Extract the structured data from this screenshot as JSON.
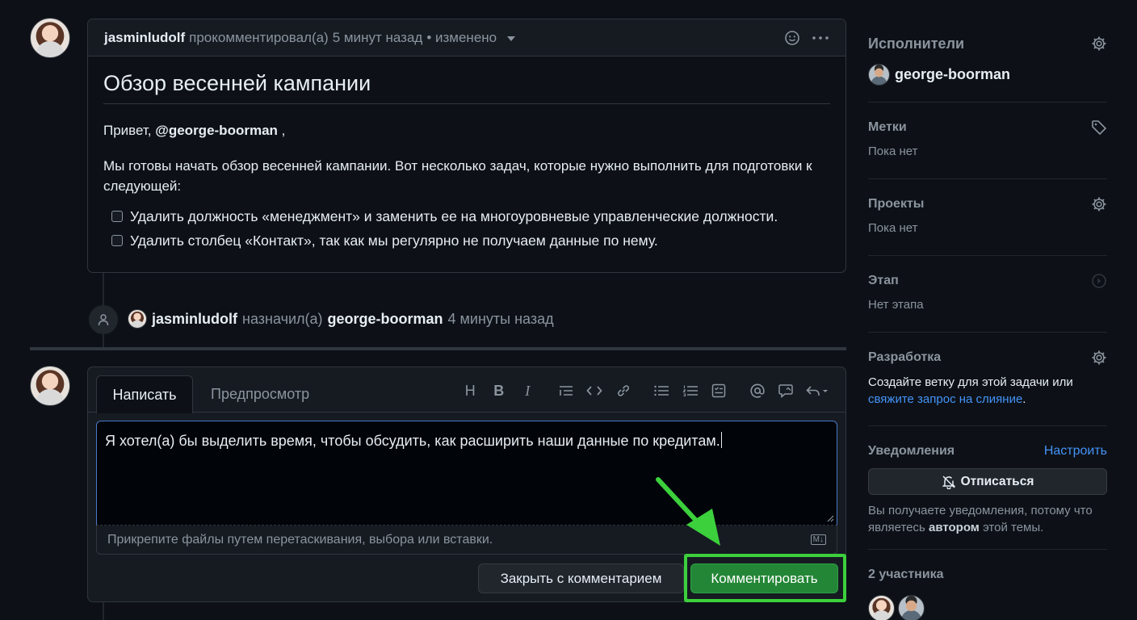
{
  "comment": {
    "author": "jasminludolf",
    "action": "прокомментировал(а)",
    "time": "5 минут назад",
    "edited": "• изменено",
    "title": "Обзор весенней кампании",
    "greeting": "Привет,",
    "mention": "@george-boorman",
    "greeting_end": ",",
    "paragraph": "Мы готовы начать обзор весенней кампании. Вот несколько задач, которые нужно выполнить для подготовки к следующей:",
    "tasks": [
      "Удалить должность «менеджмент» и заменить ее на многоуровневые управленческие должности.",
      "Удалить столбец «Контакт», так как мы регулярно не получаем данные по нему."
    ]
  },
  "event": {
    "actor": "jasminludolf",
    "action": "назначил(а)",
    "target": "george-boorman",
    "time": "4 минуты назад"
  },
  "editor": {
    "tab_write": "Написать",
    "tab_preview": "Предпросмотр",
    "toolbar": {
      "heading": "H",
      "bold": "B",
      "italic": "I"
    },
    "text": "Я хотел(а) бы выделить время, чтобы обсудить, как расширить наши данные по кредитам.",
    "attach_hint": "Прикрепите файлы путем перетаскивания, выбора или вставки.",
    "close_button": "Закрыть с комментарием",
    "comment_button": "Комментировать"
  },
  "sidebar": {
    "assignees_label": "Исполнители",
    "assignee_name": "george-boorman",
    "labels_label": "Метки",
    "labels_value": "Пока нет",
    "projects_label": "Проекты",
    "projects_value": "Пока нет",
    "milestone_label": "Этап",
    "milestone_value": "Нет этапа",
    "development_label": "Разработка",
    "development_text": "Создайте ветку для этой задачи или",
    "development_link": "свяжите запрос на слияние",
    "development_end": ".",
    "notifications_label": "Уведомления",
    "notifications_configure": "Настроить",
    "unsubscribe_button": "Отписаться",
    "notif_text_1": "Вы получаете уведомления, потому что являетесь",
    "notif_text_bold": "автором",
    "notif_text_2": "этой темы.",
    "participants_label": "2 участника"
  },
  "colors": {
    "background": "#0d1117",
    "accent_green": "#238636",
    "highlight": "#3cd03c",
    "link": "#4493f8"
  }
}
